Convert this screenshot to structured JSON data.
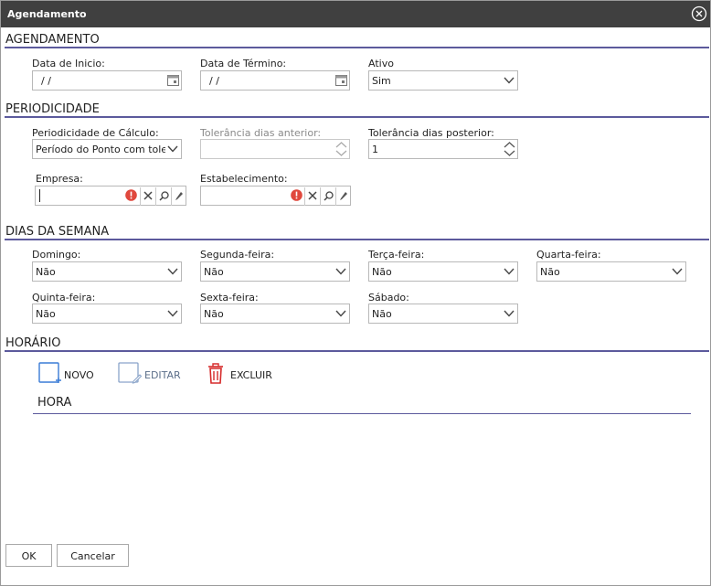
{
  "dialog": {
    "title": "Agendamento"
  },
  "sections": {
    "agendamento": "AGENDAMENTO",
    "periodicidade": "PERIODICIDADE",
    "dias_semana": "DIAS DA SEMANA",
    "horario": "HORÁRIO"
  },
  "agendamento": {
    "data_inicio": {
      "label": "Data de Inicio:",
      "value": " /  /"
    },
    "data_termino": {
      "label": "Data de Término:",
      "value": " /  /"
    },
    "ativo": {
      "label": "Ativo",
      "value": "Sim"
    }
  },
  "periodicidade": {
    "calculo": {
      "label": "Periodicidade de Cálculo:",
      "value": "Período do Ponto com tolerância"
    },
    "tol_anterior": {
      "label": "Tolerância dias anterior:",
      "value": ""
    },
    "tol_posterior": {
      "label": "Tolerância dias posterior:",
      "value": "1"
    },
    "empresa": {
      "label": "Empresa:",
      "value": ""
    },
    "estabelecimento": {
      "label": "Estabelecimento:",
      "value": ""
    }
  },
  "dias": {
    "domingo": {
      "label": "Domingo:",
      "value": "Não"
    },
    "segunda": {
      "label": "Segunda-feira:",
      "value": "Não"
    },
    "terca": {
      "label": "Terça-feira:",
      "value": "Não"
    },
    "quarta": {
      "label": "Quarta-feira:",
      "value": "Não"
    },
    "quinta": {
      "label": "Quinta-feira:",
      "value": "Não"
    },
    "sexta": {
      "label": "Sexta-feira:",
      "value": "Não"
    },
    "sabado": {
      "label": "Sábado:",
      "value": "Não"
    }
  },
  "horario": {
    "novo": "NOVO",
    "editar": "EDITAR",
    "excluir": "EXCLUIR",
    "col_hora": "HORA"
  },
  "footer": {
    "ok": "OK",
    "cancelar": "Cancelar"
  },
  "colors": {
    "accent": "#5c5a9c",
    "titlebar": "#404040",
    "error": "#e0483d",
    "delete": "#d62b2b",
    "new": "#3a7bd5"
  }
}
